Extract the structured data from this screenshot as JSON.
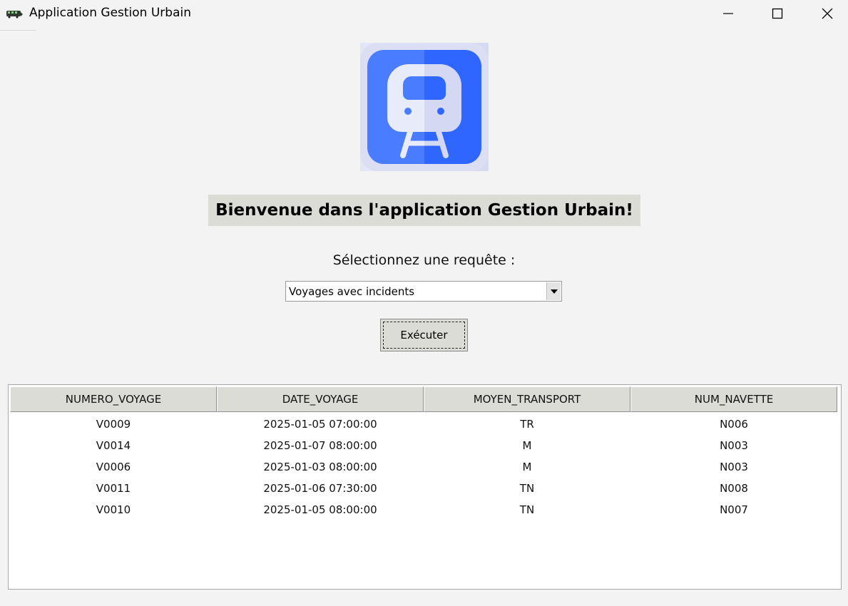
{
  "window": {
    "title": "Application Gestion Urbain",
    "icon": "train-icon",
    "controls": [
      "minimize-icon",
      "maximize-icon",
      "close-icon"
    ]
  },
  "logo": {
    "icon": "train-front-icon",
    "colors": {
      "background_left": "#4a7cff",
      "background_right": "#2e66ff",
      "frame": "#e3e6f6"
    }
  },
  "welcome": {
    "text": "Bienvenue dans l'application Gestion Urbain!"
  },
  "query": {
    "label": "Sélectionnez une requête :",
    "selected": "Voyages avec incidents",
    "execute_label": "Exécuter"
  },
  "results": {
    "columns": [
      "NUMERO_VOYAGE",
      "DATE_VOYAGE",
      "MOYEN_TRANSPORT",
      "NUM_NAVETTE"
    ],
    "rows": [
      [
        "V0009",
        "2025-01-05 07:00:00",
        "TR",
        "N006"
      ],
      [
        "V0014",
        "2025-01-07 08:00:00",
        "M",
        "N003"
      ],
      [
        "V0006",
        "2025-01-03 08:00:00",
        "M",
        "N003"
      ],
      [
        "V0011",
        "2025-01-06 07:30:00",
        "TN",
        "N008"
      ],
      [
        "V0010",
        "2025-01-05 08:00:00",
        "TN",
        "N007"
      ]
    ]
  }
}
